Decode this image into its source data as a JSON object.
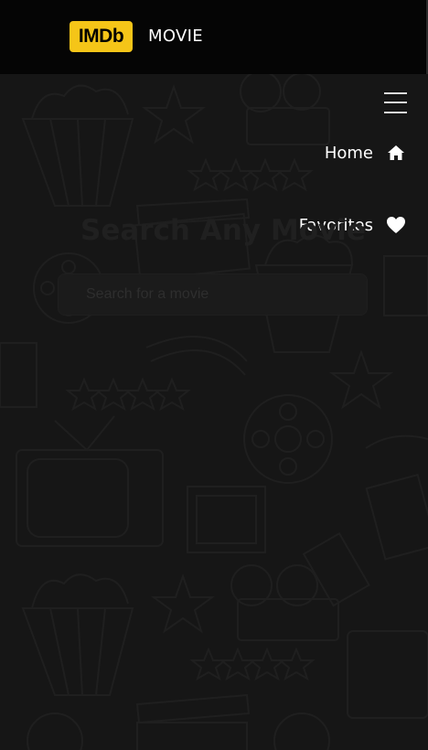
{
  "header": {
    "logo_text": "IMDb",
    "brand_label": "MOVIE"
  },
  "nav": {
    "items": [
      {
        "label": "Home",
        "icon": "home-icon"
      },
      {
        "label": "Favorites",
        "icon": "heart-icon"
      }
    ],
    "menu_icon": "hamburger-icon"
  },
  "hero": {
    "title": "Search Any Movie",
    "search_placeholder": "Search for a movie"
  },
  "colors": {
    "brand_yellow": "#f5c518",
    "topbar": "#050505",
    "background": "#161616",
    "text": "#ffffff"
  }
}
